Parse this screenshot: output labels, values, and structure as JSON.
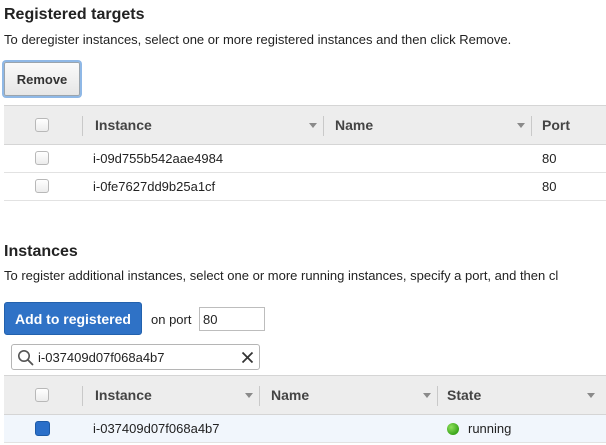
{
  "registered": {
    "title": "Registered targets",
    "description": "To deregister instances, select one or more registered instances and then click Remove.",
    "remove_label": "Remove",
    "columns": {
      "instance": "Instance",
      "name": "Name",
      "port": "Port"
    },
    "rows": [
      {
        "instance": "i-09d755b542aae4984",
        "name": "",
        "port": "80"
      },
      {
        "instance": "i-0fe7627dd9b25a1cf",
        "name": "",
        "port": "80"
      }
    ]
  },
  "instances": {
    "title": "Instances",
    "description": "To register additional instances, select one or more running instances, specify a port, and then cl",
    "add_label": "Add to registered",
    "on_port_label": "on port",
    "port_value": "80",
    "search_value": "i-037409d07f068a4b7",
    "columns": {
      "instance": "Instance",
      "name": "Name",
      "state": "State"
    },
    "rows": [
      {
        "instance": "i-037409d07f068a4b7",
        "name": "",
        "state": "running",
        "selected": true
      }
    ]
  },
  "colors": {
    "primary": "#2f72c6",
    "running": "#3aa51b",
    "selected_row": "#f1f6fc"
  },
  "icons": {
    "search": "search-icon",
    "clear": "close-icon",
    "sort": "triangle-down-icon",
    "status": "status-dot-icon"
  }
}
